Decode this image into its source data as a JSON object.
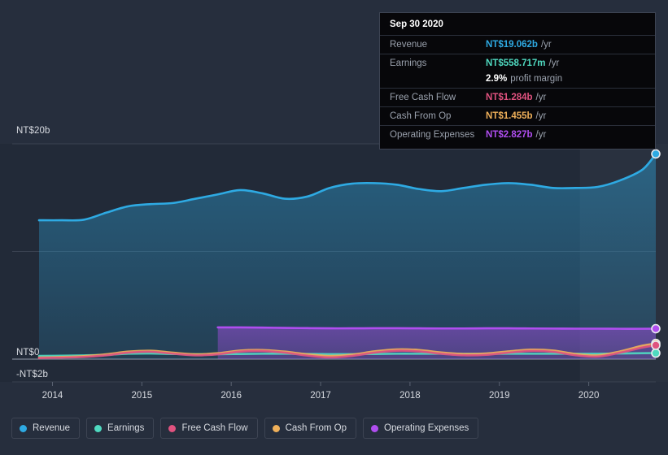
{
  "colors": {
    "background": "#262e3d",
    "plot_background": "#222a38",
    "revenue": "#2eaae3",
    "earnings": "#4fd9c0",
    "free_cash_flow": "#e0527f",
    "cash_from_op": "#efb05a",
    "operating_expenses": "#b04ef0",
    "grid": "#3a4251",
    "axis_text": "#d7dae0",
    "tooltip_bg": "#07070a",
    "tooltip_border": "#3d4453"
  },
  "tooltip": {
    "date": "Sep 30 2020",
    "rows": [
      {
        "key": "Revenue",
        "value": "NT$19.062b",
        "unit": "/yr",
        "color": "#2eaae3"
      },
      {
        "key": "Earnings",
        "value": "NT$558.717m",
        "unit": "/yr",
        "color": "#4fd9c0"
      },
      {
        "key": "",
        "value": "2.9%",
        "unit": "profit margin",
        "color": "#ffffff"
      },
      {
        "key": "Free Cash Flow",
        "value": "NT$1.284b",
        "unit": "/yr",
        "color": "#e0527f"
      },
      {
        "key": "Cash From Op",
        "value": "NT$1.455b",
        "unit": "/yr",
        "color": "#efb05a"
      },
      {
        "key": "Operating Expenses",
        "value": "NT$2.827b",
        "unit": "/yr",
        "color": "#b04ef0"
      }
    ]
  },
  "legend": {
    "items": [
      {
        "label": "Revenue",
        "color": "#2eaae3"
      },
      {
        "label": "Earnings",
        "color": "#4fd9c0"
      },
      {
        "label": "Free Cash Flow",
        "color": "#e0527f"
      },
      {
        "label": "Cash From Op",
        "color": "#efb05a"
      },
      {
        "label": "Operating Expenses",
        "color": "#b04ef0"
      }
    ]
  },
  "axes": {
    "y_labels": {
      "top": "NT$20b",
      "zero": "NT$0",
      "bottom": "-NT$2b"
    },
    "x_labels": [
      "2014",
      "2015",
      "2016",
      "2017",
      "2018",
      "2019",
      "2020"
    ]
  },
  "chart_data": {
    "type": "area",
    "title": "",
    "xlabel": "",
    "ylabel": "NT$",
    "ylim": [
      -2,
      20
    ],
    "yticks": [
      -2,
      0,
      10,
      20
    ],
    "ytick_labels": [
      "-NT$2b",
      "NT$0",
      "",
      "NT$20b"
    ],
    "grid": true,
    "legend_position": "bottom",
    "x": [
      2013.85,
      2014.1,
      2014.35,
      2014.6,
      2014.85,
      2015.1,
      2015.35,
      2015.6,
      2015.85,
      2016.1,
      2016.35,
      2016.6,
      2016.85,
      2017.1,
      2017.35,
      2017.6,
      2017.85,
      2018.1,
      2018.35,
      2018.6,
      2018.85,
      2019.1,
      2019.35,
      2019.6,
      2019.85,
      2020.1,
      2020.35,
      2020.6,
      2020.75
    ],
    "x_range": [
      2013.85,
      2020.75
    ],
    "forecast_start": 2019.9,
    "series": [
      {
        "name": "Revenue",
        "color": "#2eaae3",
        "filled": true,
        "values": [
          12.9,
          12.9,
          12.95,
          13.6,
          14.2,
          14.4,
          14.5,
          14.9,
          15.3,
          15.7,
          15.4,
          14.9,
          15.1,
          15.9,
          16.3,
          16.35,
          16.2,
          15.8,
          15.6,
          15.9,
          16.2,
          16.35,
          16.2,
          15.9,
          15.9,
          16.0,
          16.6,
          17.6,
          19.062
        ],
        "end_label": "NT$19.062b"
      },
      {
        "name": "Operating Expenses",
        "color": "#b04ef0",
        "filled": true,
        "start_x": 2015.75,
        "values": [
          null,
          null,
          null,
          null,
          null,
          null,
          null,
          null,
          2.95,
          2.95,
          2.93,
          2.9,
          2.88,
          2.86,
          2.86,
          2.87,
          2.87,
          2.86,
          2.85,
          2.85,
          2.86,
          2.86,
          2.85,
          2.84,
          2.83,
          2.83,
          2.82,
          2.82,
          2.827
        ],
        "end_label": "NT$2.827b"
      },
      {
        "name": "Cash From Op",
        "color": "#efb05a",
        "filled": false,
        "values": [
          0.15,
          0.2,
          0.28,
          0.45,
          0.7,
          0.78,
          0.6,
          0.45,
          0.55,
          0.8,
          0.85,
          0.7,
          0.45,
          0.3,
          0.42,
          0.72,
          0.9,
          0.85,
          0.62,
          0.48,
          0.52,
          0.72,
          0.88,
          0.8,
          0.48,
          0.35,
          0.72,
          1.25,
          1.455
        ],
        "end_label": "NT$1.455b"
      },
      {
        "name": "Free Cash Flow",
        "color": "#e0527f",
        "filled": false,
        "values": [
          0.1,
          0.14,
          0.2,
          0.35,
          0.6,
          0.68,
          0.5,
          0.35,
          0.45,
          0.7,
          0.75,
          0.6,
          0.33,
          0.16,
          0.3,
          0.6,
          0.78,
          0.72,
          0.5,
          0.36,
          0.4,
          0.6,
          0.76,
          0.68,
          0.36,
          0.24,
          0.6,
          1.08,
          1.284
        ],
        "end_label": "NT$1.284b"
      },
      {
        "name": "Earnings",
        "color": "#4fd9c0",
        "filled": false,
        "values": [
          0.3,
          0.32,
          0.35,
          0.4,
          0.5,
          0.52,
          0.48,
          0.45,
          0.46,
          0.48,
          0.5,
          0.5,
          0.48,
          0.46,
          0.46,
          0.48,
          0.5,
          0.5,
          0.5,
          0.49,
          0.49,
          0.5,
          0.5,
          0.5,
          0.5,
          0.5,
          0.52,
          0.55,
          0.558717
        ],
        "end_label": "NT$558.717m"
      }
    ]
  }
}
